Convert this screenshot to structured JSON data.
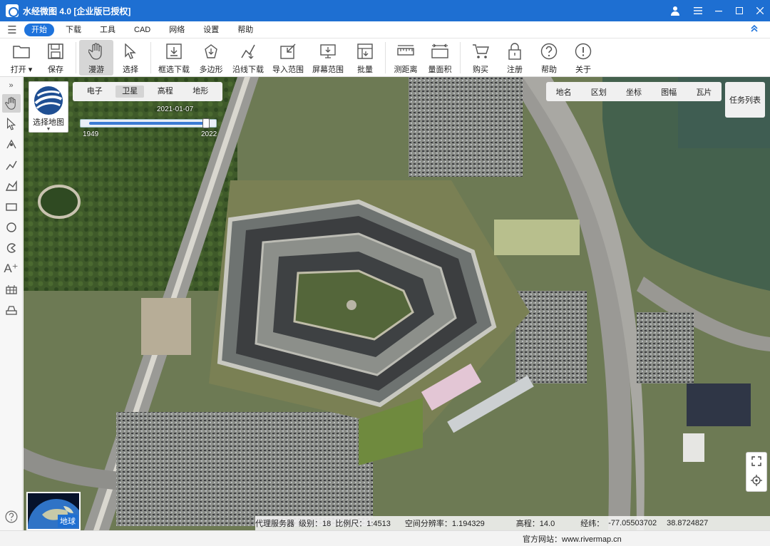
{
  "window": {
    "title": "水经微图 4.0 [企业版已授权]"
  },
  "menu": {
    "tabs": [
      "开始",
      "下载",
      "工具",
      "CAD",
      "网络",
      "设置",
      "帮助"
    ],
    "active_tab": "开始"
  },
  "ribbon": {
    "open": "打开",
    "save": "保存",
    "roam": "漫游",
    "select": "选择",
    "box_download": "框选下载",
    "polygon": "多边形",
    "line_download": "沿线下载",
    "import_range": "导入范围",
    "screen_range": "屏幕范围",
    "batch": "批量",
    "measure_distance": "测距离",
    "measure_area": "量面积",
    "buy": "购买",
    "register": "注册",
    "help": "帮助",
    "about": "关于"
  },
  "map": {
    "layer_picker_label": "选择地图",
    "map_types": [
      "电子",
      "卫星",
      "高程",
      "地形"
    ],
    "active_map_type": "卫星",
    "timeline": {
      "date": "2021-01-07",
      "start_year": "1949",
      "end_year": "2022"
    },
    "overlays": [
      "地名",
      "区划",
      "坐标",
      "图幅",
      "瓦片"
    ],
    "task_list": "任务列表",
    "earth_button": "地球"
  },
  "status": {
    "proxy": "代理服务器",
    "level": "级别：18",
    "scale": "比例尺：1:4513",
    "resolution": "空间分辨率：1.194329",
    "elevation": "高程：14.0",
    "coords_label": "经纬：",
    "lon": "-77.05503702",
    "lat": "38.8724827",
    "website": "官方网站：www.rivermap.cn"
  },
  "colors": {
    "titlebar": "#1e6fd2",
    "accent": "#1e73dc"
  }
}
